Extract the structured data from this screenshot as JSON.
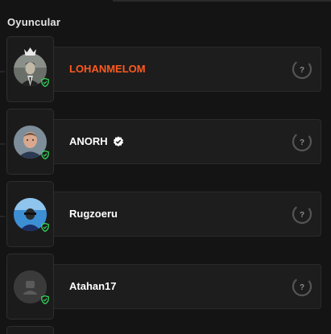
{
  "section": {
    "title": "Oyuncular"
  },
  "players": [
    {
      "name": "LOHANMELOM",
      "highlight": true,
      "leader": true,
      "verified": false,
      "rank": "?"
    },
    {
      "name": "ANORH",
      "highlight": false,
      "leader": false,
      "verified": true,
      "rank": "?"
    },
    {
      "name": "Rugzoeru",
      "highlight": false,
      "leader": false,
      "verified": false,
      "rank": "?"
    },
    {
      "name": "Atahan17",
      "highlight": false,
      "leader": false,
      "verified": false,
      "rank": "?"
    }
  ],
  "colors": {
    "highlight_name": "#ff5a1f",
    "shield": "#36d15a",
    "rank_ring": "#555555"
  }
}
